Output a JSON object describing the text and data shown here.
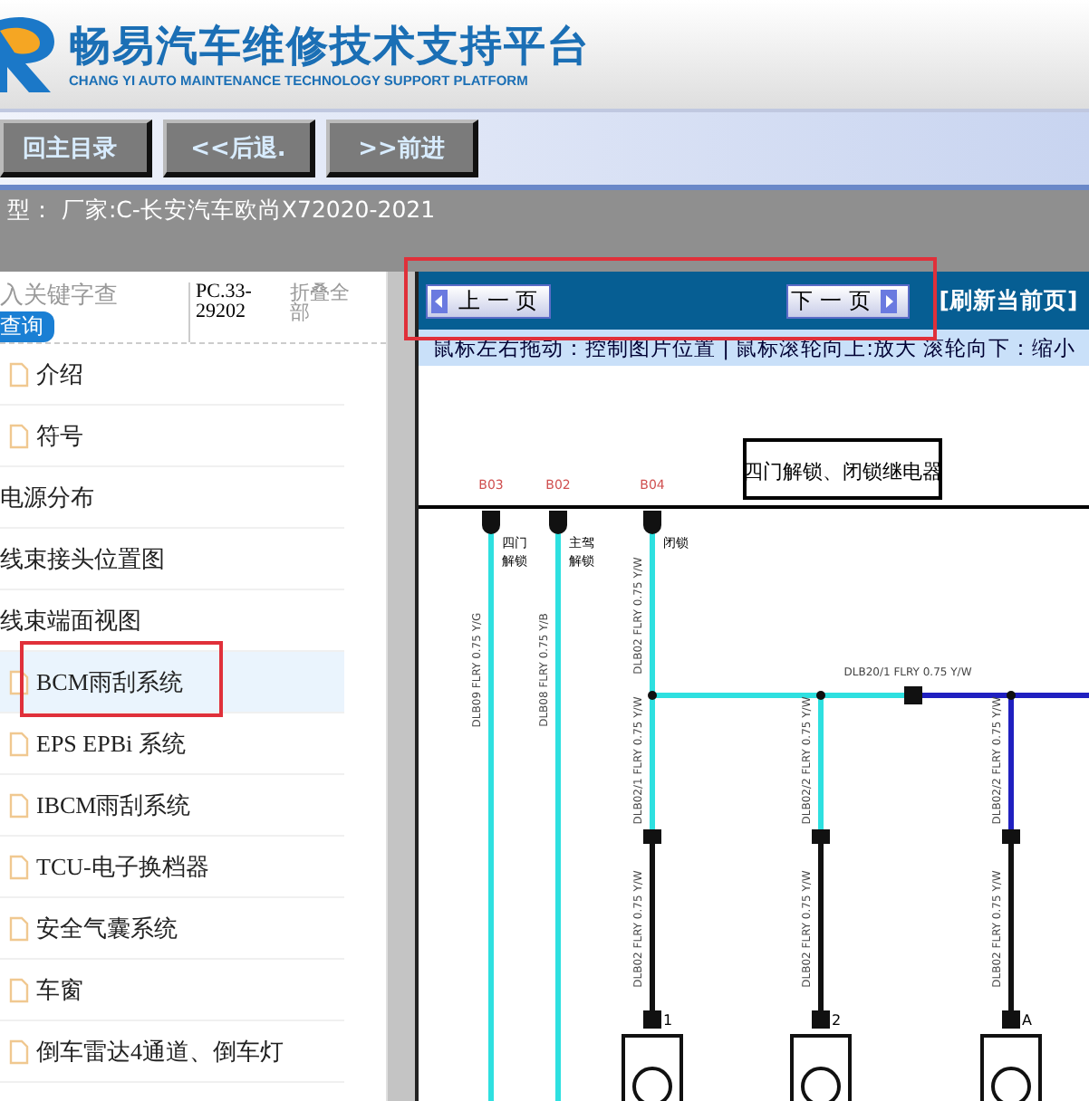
{
  "header": {
    "title": "畅易汽车维修技术支持平台",
    "subtitle": "CHANG YI AUTO MAINTENANCE TECHNOLOGY SUPPORT PLATFORM"
  },
  "nav_buttons": [
    "回主目录",
    "<<后退.",
    ">>前进"
  ],
  "model_line": "型： 厂家:C-长安汽车欧尚X72020-2021",
  "sidebar": {
    "search": {
      "placeholder": "入关键字查"
    },
    "search_button": "查询",
    "code": "PC.33-29202",
    "collapse_all": "折叠全部",
    "items": [
      {
        "label": "介绍",
        "kind": "doc",
        "selected": false
      },
      {
        "label": "符号",
        "kind": "doc",
        "selected": false
      },
      {
        "label": "电源分布",
        "kind": "group",
        "selected": false
      },
      {
        "label": "线束接头位置图",
        "kind": "group",
        "selected": false
      },
      {
        "label": "线束端面视图",
        "kind": "group",
        "selected": false
      },
      {
        "label": "BCM雨刮系统",
        "kind": "doc",
        "selected": true
      },
      {
        "label": "EPS EPBi 系统",
        "kind": "doc",
        "selected": false
      },
      {
        "label": "IBCM雨刮系统",
        "kind": "doc",
        "selected": false
      },
      {
        "label": "TCU-电子换档器",
        "kind": "doc",
        "selected": false
      },
      {
        "label": "安全气囊系统",
        "kind": "doc",
        "selected": false
      },
      {
        "label": "车窗",
        "kind": "doc",
        "selected": false
      },
      {
        "label": "倒车雷达4通道、倒车灯",
        "kind": "doc",
        "selected": false
      }
    ]
  },
  "viewer": {
    "prev_button": "上 一 页",
    "next_button": "下 一 页",
    "refresh_link": "[刷新当前页]",
    "hint": "鼠标左右拖动：控制图片位置 | 鼠标滚轮向上:放大  滚轮向下：缩小",
    "diagram": {
      "title": "四门解锁、闭锁继电器",
      "pins": [
        "B03",
        "B02",
        "B04"
      ],
      "signals": [
        "四门解锁",
        "主驾解锁",
        "闭锁"
      ],
      "wire_labels": [
        "DLB09 FLRY 0.75 Y/G",
        "DLB08 FLRY 0.75 Y/B",
        "DLB02 FLRY 0.75 Y/W",
        "DLB02/1 FLRY 0.75 Y/W",
        "DLB02/2 FLRY 0.75 Y/W",
        "DLB02/2 FLRY 0.75 Y/W",
        "DLB20/1 FLRY 0.75 Y/W",
        "DLB02 FLRY 0.75 Y/W",
        "DLB02 FLRY 0.75 Y/W",
        "DLB02 FLRY 0.75 Y/W"
      ],
      "motor_pins": [
        "1",
        "2",
        "A"
      ]
    }
  }
}
